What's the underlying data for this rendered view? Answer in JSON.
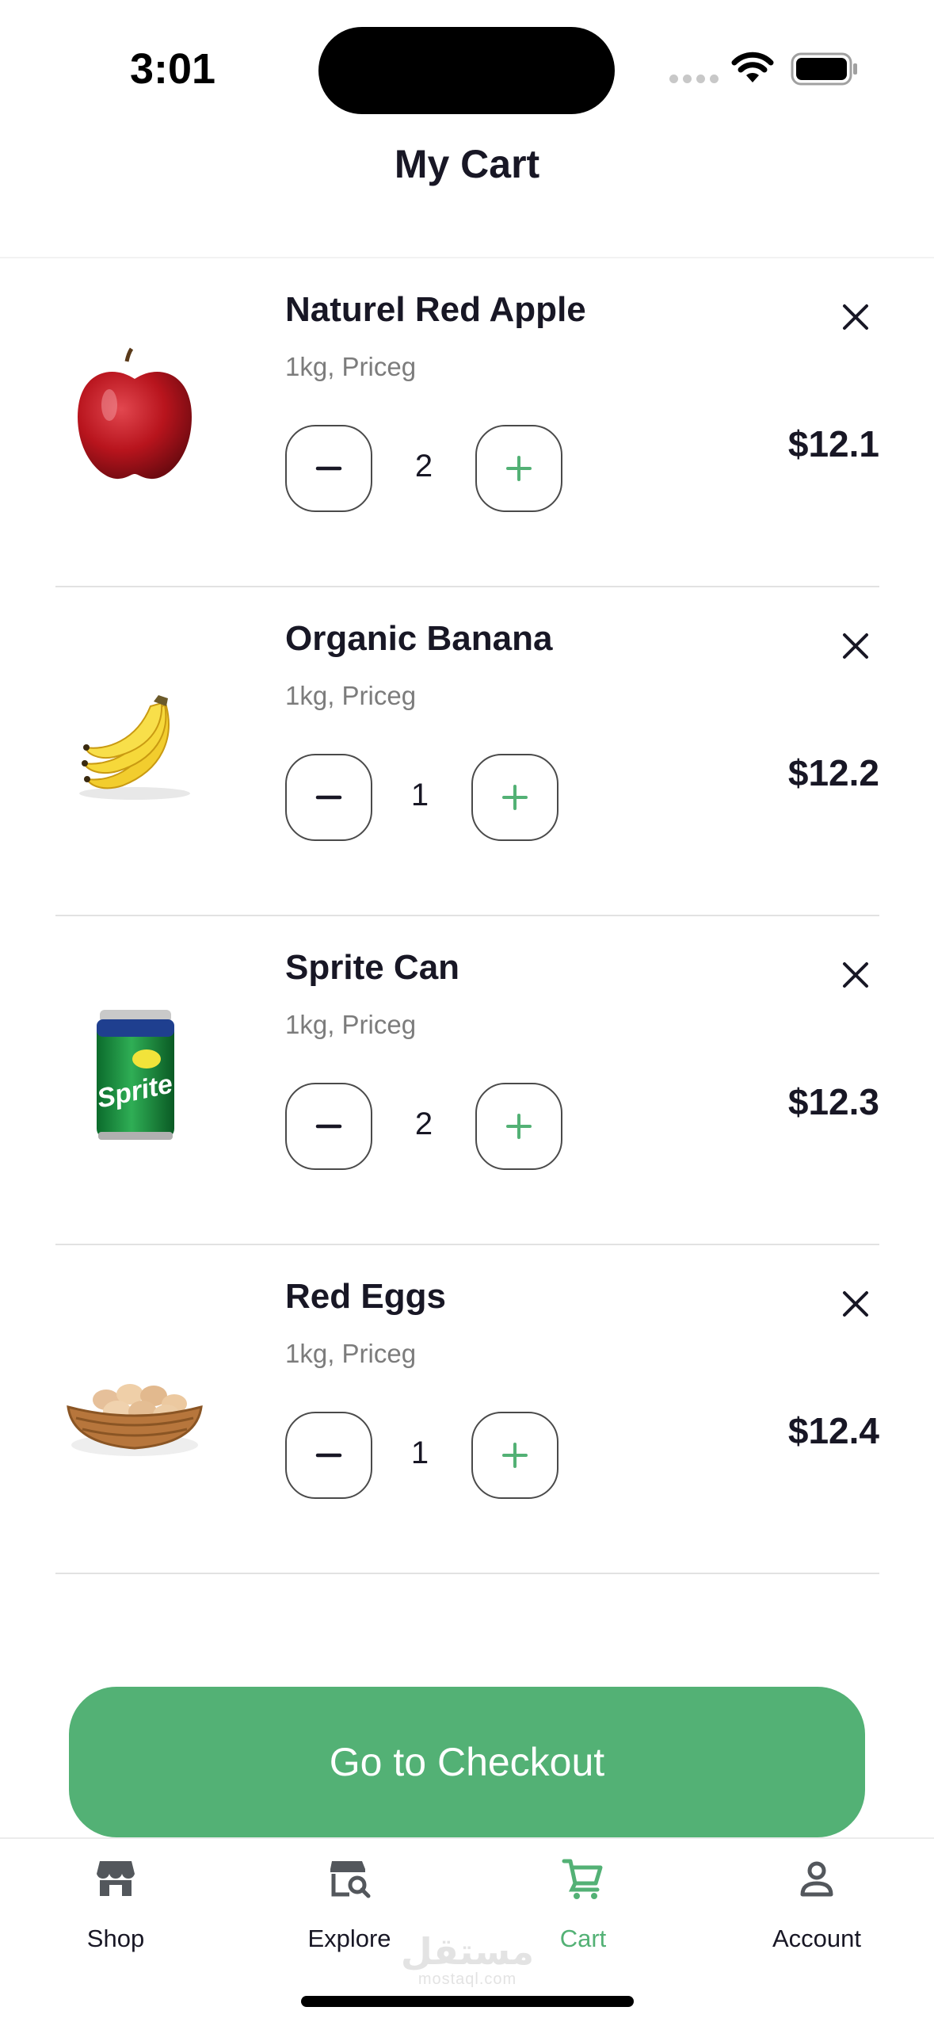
{
  "status_bar": {
    "time": "3:01"
  },
  "header": {
    "title": "My Cart"
  },
  "cart": {
    "items": [
      {
        "name": "Naturel Red Apple",
        "desc": "1kg, Priceg",
        "qty": "2",
        "price": "$12.1",
        "image": "red-apple-icon"
      },
      {
        "name": "Organic Banana",
        "desc": "1kg, Priceg",
        "qty": "1",
        "price": "$12.2",
        "image": "banana-icon"
      },
      {
        "name": "Sprite Can",
        "desc": "1kg, Priceg",
        "qty": "2",
        "price": "$12.3",
        "image": "sprite-can-icon"
      },
      {
        "name": "Red Eggs",
        "desc": "1kg, Priceg",
        "qty": "1",
        "price": "$12.4",
        "image": "egg-basket-icon"
      }
    ]
  },
  "can_text": "Sprite",
  "checkout": {
    "label": "Go to Checkout"
  },
  "nav": {
    "tabs": [
      {
        "label": "Shop",
        "icon": "store-icon"
      },
      {
        "label": "Explore",
        "icon": "explore-icon"
      },
      {
        "label": "Cart",
        "icon": "cart-icon",
        "active": true
      },
      {
        "label": "Account",
        "icon": "account-icon"
      }
    ]
  },
  "watermark": {
    "arabic": "مستقل",
    "url": "mostaql.com"
  },
  "colors": {
    "accent": "#53B175",
    "text": "#181725",
    "muted": "#7C7C7C"
  }
}
